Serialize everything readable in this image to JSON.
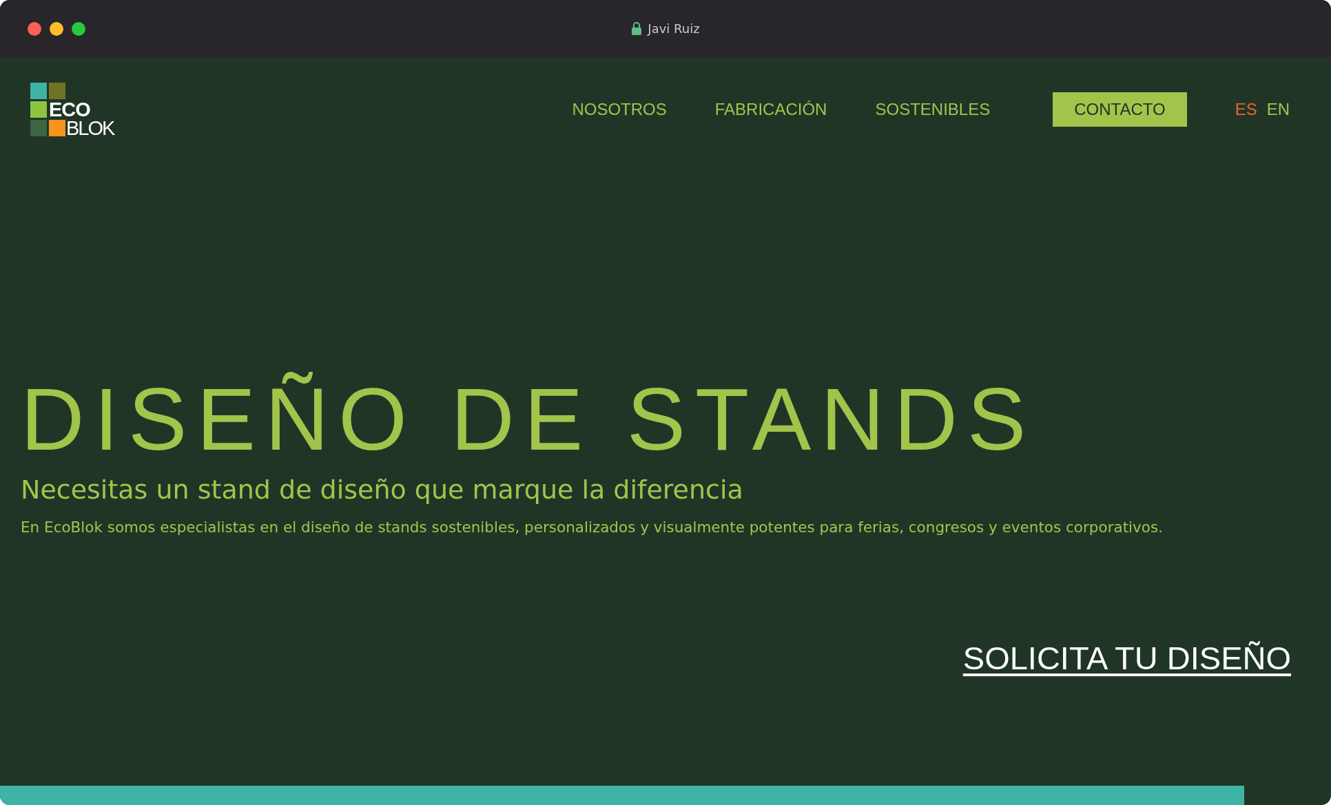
{
  "window": {
    "title": "Javi Ruiz"
  },
  "logo": {
    "line_1": "ECO",
    "line_2": "BLOK"
  },
  "nav": {
    "links": [
      "NOSOTROS",
      "FABRICACIÓN",
      "SOSTENIBLES"
    ],
    "contact": "CONTACTO",
    "languages": [
      {
        "label": "ES",
        "selected": true
      },
      {
        "label": "EN",
        "selected": false
      }
    ]
  },
  "hero": {
    "title": "DISEÑO DE STANDS",
    "subtitle": "Necesitas un stand de diseño que marque la diferencia",
    "text": "En EcoBlok somos especialistas en el diseño de stands sostenibles, personalizados y visualmente potentes para ferias, congresos y eventos corporativos.",
    "cta": "SOLICITA TU DISEÑO"
  },
  "progress": {
    "level": 0.935
  }
}
